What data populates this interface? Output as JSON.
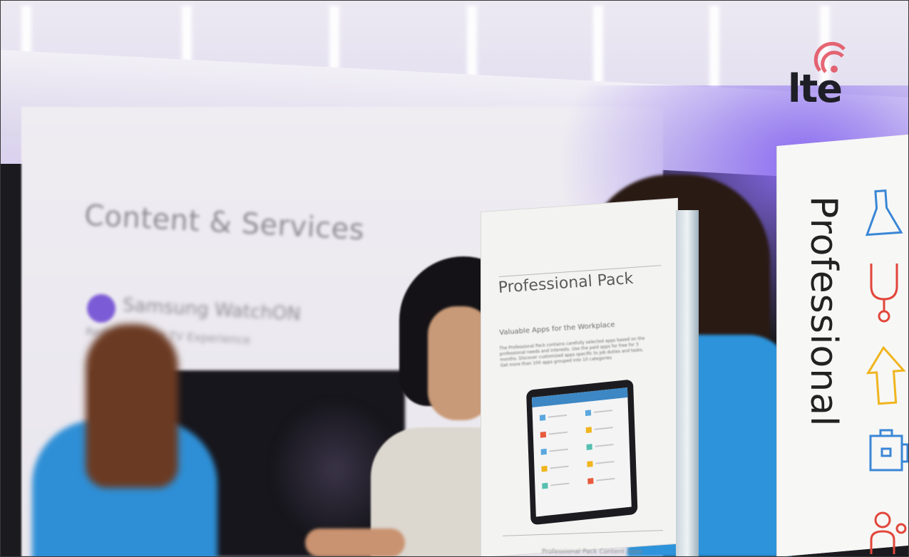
{
  "scene": {
    "description_text": {
      "wall_heading": "Content & Services",
      "wall_app_title": "Samsung WatchON",
      "wall_app_subtitle": "Redefine your TV Experience"
    },
    "logo": {
      "text": "lte",
      "icon": "wireless-signal-icon"
    },
    "brochure": {
      "title": "Professional Pack",
      "subtitle": "Valuable Apps for the Workplace",
      "body": "The Professional Pack contains carefully selected apps based on the professional needs and interests. Use the paid apps for free for 3 months. Discover customized apps specific to job duties and tasks. Get more than 100 apps grouped into 10 categories",
      "footer": "Professional Pack Content Apps"
    },
    "sign": {
      "text": "Professional",
      "icons": [
        "flask-icon",
        "stethoscope-icon",
        "arrow-icon",
        "briefcase-icon",
        "person-icon"
      ]
    },
    "colors": {
      "accent_purple": "#8a6cf0",
      "shirt_blue": "#2e8fd6",
      "icon_blue": "#3a87d6",
      "icon_red": "#e2463a",
      "icon_yellow": "#f0b51e"
    }
  }
}
